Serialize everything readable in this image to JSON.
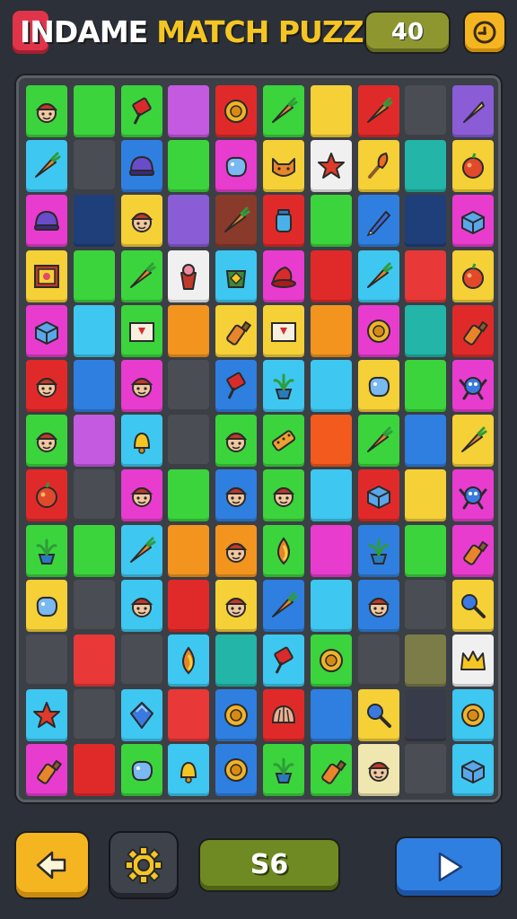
{
  "header": {
    "title_part1": "INDAME",
    "title_part2": "MATCH PUZZLE",
    "score": "40",
    "hint_icon": "hint-icon"
  },
  "footer": {
    "moves": "S6",
    "back_icon": "back-icon",
    "settings_icon": "gear-icon",
    "play_icon": "play-icon"
  },
  "board": {
    "columns": 10,
    "rows": 13,
    "rows_data": [
      [
        [
          "#3bd43c",
          "face"
        ],
        [
          "#3bd43c",
          ""
        ],
        [
          "#3bd43c",
          "pin"
        ],
        [
          "#c45ae0",
          ""
        ],
        [
          "#e02a2a",
          "coin"
        ],
        [
          "#3bd43c",
          "carrot"
        ],
        [
          "#f5d037",
          ""
        ],
        [
          "#e02a2a",
          "carrot"
        ],
        [
          "#4a4d53",
          ""
        ],
        [
          "#8a5cd6",
          "cone"
        ]
      ],
      [
        [
          "#3ec7f0",
          "carrot"
        ],
        [
          "#4a4d53",
          ""
        ],
        [
          "#2f7fe0",
          "helmet"
        ],
        [
          "#3bd43c",
          ""
        ],
        [
          "#e83ccf",
          "blob"
        ],
        [
          "#f5d037",
          "fox"
        ],
        [
          "#f0f0f0",
          "star"
        ],
        [
          "#f5d037",
          "torch"
        ],
        [
          "#22b5a8",
          ""
        ],
        [
          "#f5d037",
          "fruit"
        ]
      ],
      [
        [
          "#e83ccf",
          "helmet"
        ],
        [
          "#1f3f7a",
          ""
        ],
        [
          "#f5d037",
          "face"
        ],
        [
          "#8a5cd6",
          ""
        ],
        [
          "#8a3a2a",
          "carrot"
        ],
        [
          "#e02a2a",
          "jar"
        ],
        [
          "#3bd43c",
          ""
        ],
        [
          "#2f7fe0",
          "pen"
        ],
        [
          "#1f3f7a",
          ""
        ],
        [
          "#e83ccf",
          "box"
        ]
      ],
      [
        [
          "#f5d037",
          "frame"
        ],
        [
          "#3bd43c",
          ""
        ],
        [
          "#3bd43c",
          "carrot"
        ],
        [
          "#f0f0f0",
          "cup"
        ],
        [
          "#3ec7f0",
          "pot"
        ],
        [
          "#e83ccf",
          "hat"
        ],
        [
          "#e02a2a",
          ""
        ],
        [
          "#3ec7f0",
          "carrot"
        ],
        [
          "#e83838",
          ""
        ],
        [
          "#f5d037",
          "fruit"
        ]
      ],
      [
        [
          "#e83ccf",
          "box"
        ],
        [
          "#3ec7f0",
          ""
        ],
        [
          "#3bd43c",
          "card"
        ],
        [
          "#f2941e",
          ""
        ],
        [
          "#f5d037",
          "bottle"
        ],
        [
          "#f5d037",
          "card"
        ],
        [
          "#f2941e",
          ""
        ],
        [
          "#e83ccf",
          "coin"
        ],
        [
          "#22b5a8",
          ""
        ],
        [
          "#e02a2a",
          "bottle"
        ]
      ],
      [
        [
          "#e02a2a",
          "face"
        ],
        [
          "#2f7fe0",
          ""
        ],
        [
          "#e83ccf",
          "face"
        ],
        [
          "#4a4d53",
          ""
        ],
        [
          "#2f7fe0",
          "pin"
        ],
        [
          "#3ec7f0",
          "plant"
        ],
        [
          "#3ec7f0",
          ""
        ],
        [
          "#f5d037",
          "blob"
        ],
        [
          "#3bd43c",
          ""
        ],
        [
          "#e83ccf",
          "robot"
        ]
      ],
      [
        [
          "#3bd43c",
          "face"
        ],
        [
          "#c45ae0",
          ""
        ],
        [
          "#3ec7f0",
          "bell"
        ],
        [
          "#4a4d53",
          ""
        ],
        [
          "#3bd43c",
          "face"
        ],
        [
          "#3bd43c",
          "bar"
        ],
        [
          "#f25a1e",
          ""
        ],
        [
          "#3bd43c",
          "carrot"
        ],
        [
          "#2f7fe0",
          ""
        ],
        [
          "#f5d037",
          "carrot"
        ]
      ],
      [
        [
          "#e02a2a",
          "fruit"
        ],
        [
          "#4a4d53",
          ""
        ],
        [
          "#e83ccf",
          "face"
        ],
        [
          "#3bd43c",
          ""
        ],
        [
          "#2f7fe0",
          "face"
        ],
        [
          "#3bd43c",
          "face"
        ],
        [
          "#3ec7f0",
          ""
        ],
        [
          "#e02a2a",
          "box"
        ],
        [
          "#f5d037",
          ""
        ],
        [
          "#e83ccf",
          "robot"
        ]
      ],
      [
        [
          "#3bd43c",
          "plant"
        ],
        [
          "#3bd43c",
          ""
        ],
        [
          "#3ec7f0",
          "carrot"
        ],
        [
          "#f2941e",
          ""
        ],
        [
          "#f2941e",
          "face"
        ],
        [
          "#3bd43c",
          "drop"
        ],
        [
          "#e83ccf",
          ""
        ],
        [
          "#2f7fe0",
          "plant"
        ],
        [
          "#3bd43c",
          ""
        ],
        [
          "#e83ccf",
          "bottle"
        ]
      ],
      [
        [
          "#f5d037",
          "blob"
        ],
        [
          "#4a4d53",
          ""
        ],
        [
          "#3ec7f0",
          "face"
        ],
        [
          "#e02a2a",
          ""
        ],
        [
          "#f5d037",
          "face"
        ],
        [
          "#2f7fe0",
          "carrot"
        ],
        [
          "#3ec7f0",
          ""
        ],
        [
          "#2f7fe0",
          "face"
        ],
        [
          "#4a4d53",
          ""
        ],
        [
          "#f5d037",
          "key"
        ]
      ],
      [
        [
          "#4a4d53",
          ""
        ],
        [
          "#e83838",
          ""
        ],
        [
          "#4a4d53",
          ""
        ],
        [
          "#3ec7f0",
          "drop"
        ],
        [
          "#22b5a8",
          ""
        ],
        [
          "#3ec7f0",
          "pin"
        ],
        [
          "#3bd43c",
          "coin"
        ],
        [
          "#4a4d53",
          ""
        ],
        [
          "#7c7c48",
          ""
        ],
        [
          "#f0f0f0",
          "crown"
        ]
      ],
      [
        [
          "#3ec7f0",
          "star"
        ],
        [
          "#4a4d53",
          ""
        ],
        [
          "#3ec7f0",
          "gem"
        ],
        [
          "#e83838",
          ""
        ],
        [
          "#2f7fe0",
          "coin"
        ],
        [
          "#e02a2a",
          "shell"
        ],
        [
          "#2f7fe0",
          ""
        ],
        [
          "#f5d037",
          "key"
        ],
        [
          "#383c4a",
          ""
        ],
        [
          "#3ec7f0",
          "coin"
        ]
      ],
      [
        [
          "#e83ccf",
          "bottle"
        ],
        [
          "#e02a2a",
          ""
        ],
        [
          "#3bd43c",
          "blob"
        ],
        [
          "#3ec7f0",
          "bell"
        ],
        [
          "#2f7fe0",
          "coin"
        ],
        [
          "#3bd43c",
          "plant"
        ],
        [
          "#3bd43c",
          "bottle"
        ],
        [
          "#f0e6b0",
          "face"
        ],
        [
          "#4a4d53",
          ""
        ],
        [
          "#3ec7f0",
          "box"
        ]
      ]
    ]
  }
}
